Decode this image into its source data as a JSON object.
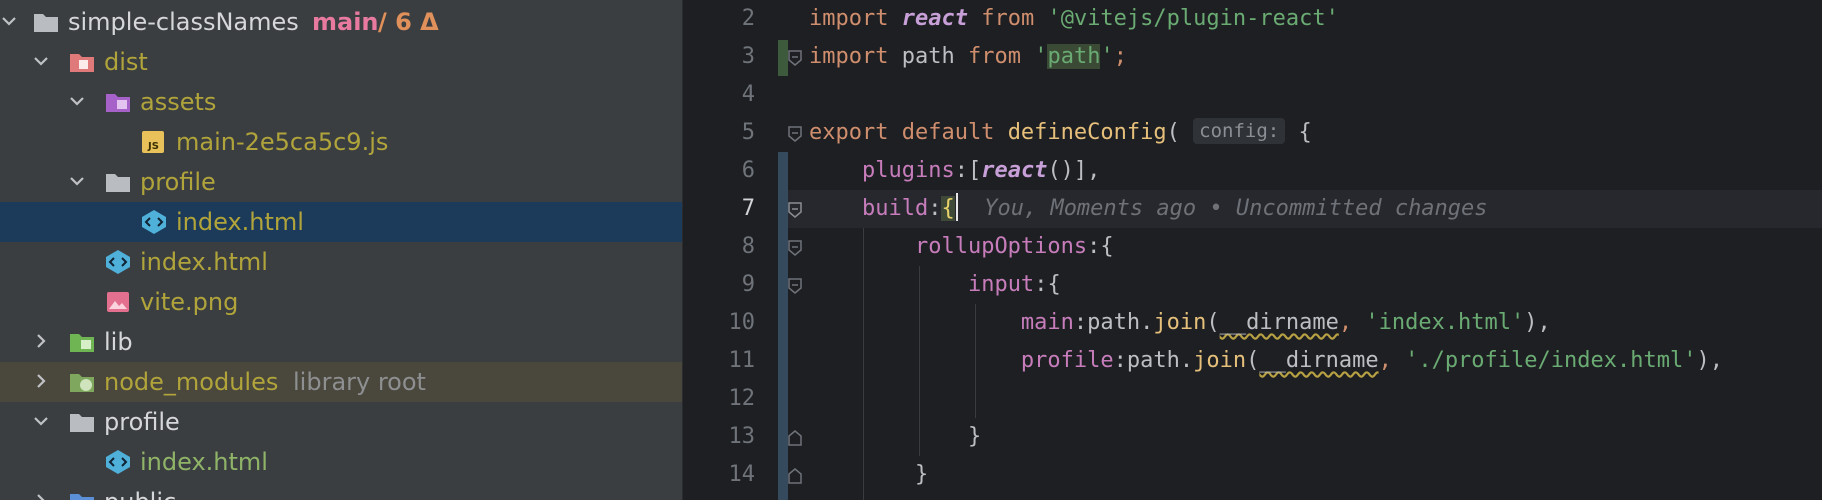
{
  "tree": {
    "rows": [
      {
        "label": "simple-classNames",
        "branch": "main",
        "changes": "/ 6 Δ",
        "icon": "folder-icon"
      },
      {
        "label": "dist",
        "icon": "folder-excluded-icon"
      },
      {
        "label": "assets",
        "icon": "folder-resource-icon"
      },
      {
        "label": "main-2e5ca5c9.js",
        "icon": "js-file-icon"
      },
      {
        "label": "profile",
        "icon": "folder-icon"
      },
      {
        "label": "index.html",
        "icon": "html-file-icon"
      },
      {
        "label": "index.html",
        "icon": "html-file-icon"
      },
      {
        "label": "vite.png",
        "icon": "image-file-icon"
      },
      {
        "label": "lib",
        "icon": "folder-source-icon"
      },
      {
        "label": "node_modules",
        "suffix": "library root",
        "icon": "folder-library-icon"
      },
      {
        "label": "profile",
        "icon": "folder-icon"
      },
      {
        "label": "index.html",
        "icon": "html-file-icon"
      },
      {
        "label": "public",
        "icon": "folder-icon"
      }
    ]
  },
  "editor": {
    "line_numbers": [
      "2",
      "3",
      "4",
      "5",
      "6",
      "7",
      "8",
      "9",
      "10",
      "11",
      "12",
      "13",
      "14"
    ],
    "current_line": "7",
    "tokens": {
      "import": "import",
      "react": "react",
      "from": "from",
      "vite_plugin": "'@vitejs/plugin-react'",
      "path": "path",
      "quote": "'",
      "semi": ";",
      "export_default": "export default",
      "defineConfig": "defineConfig",
      "paren_open": "(",
      "brace_open": "{",
      "hint_config": "config:",
      "plugins": "plugins",
      "colon_bracket": ":[",
      "react_call_tail": "()],",
      "build": "build",
      "colon": ":",
      "blame": "You, Moments ago • Uncommitted changes",
      "rollupOptions": "rollupOptions",
      "input": "input",
      "main": "main",
      "profile": "profile",
      "path_dot": "path.",
      "join": "join",
      "dirname": "__dirname",
      "comma": ",",
      "index_str": "'index.html'",
      "profile_str": "'./profile/index.html'",
      "close_paren_comma": "),",
      "brace_close": "}"
    }
  },
  "colors": {
    "selection": "#1c3a59",
    "accent_branch": "#e87aa0",
    "keyword": "#cf8e6d",
    "function": "#e6c07b",
    "string": "#6aab73"
  }
}
